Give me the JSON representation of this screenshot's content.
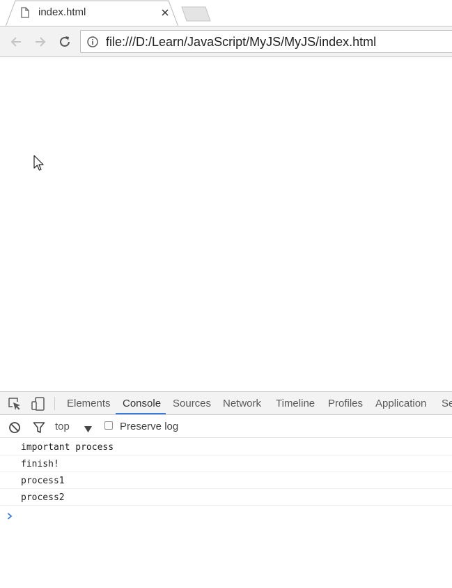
{
  "tab": {
    "title": "index.html",
    "icon": "page-icon",
    "close_icon": "close-icon"
  },
  "toolbar": {
    "back_icon": "back-arrow-icon",
    "forward_icon": "forward-arrow-icon",
    "reload_icon": "reload-icon",
    "url": "file:///D:/Learn/JavaScript/MyJS/MyJS/index.html"
  },
  "devtools": {
    "tabs": [
      {
        "label": "Elements",
        "active": false
      },
      {
        "label": "Console",
        "active": true
      },
      {
        "label": "Sources",
        "active": false
      },
      {
        "label": "Network",
        "active": false
      },
      {
        "label": "Timeline",
        "active": false
      },
      {
        "label": "Profiles",
        "active": false
      },
      {
        "label": "Application",
        "active": false
      },
      {
        "label": "Se",
        "active": false
      }
    ],
    "context": "top",
    "preserve_log": {
      "label": "Preserve log",
      "checked": false
    },
    "console_lines": [
      "important process",
      "finish!",
      "process1",
      "process2"
    ],
    "accent_color": "#3879d9",
    "prompt_color": "#3879d9"
  }
}
